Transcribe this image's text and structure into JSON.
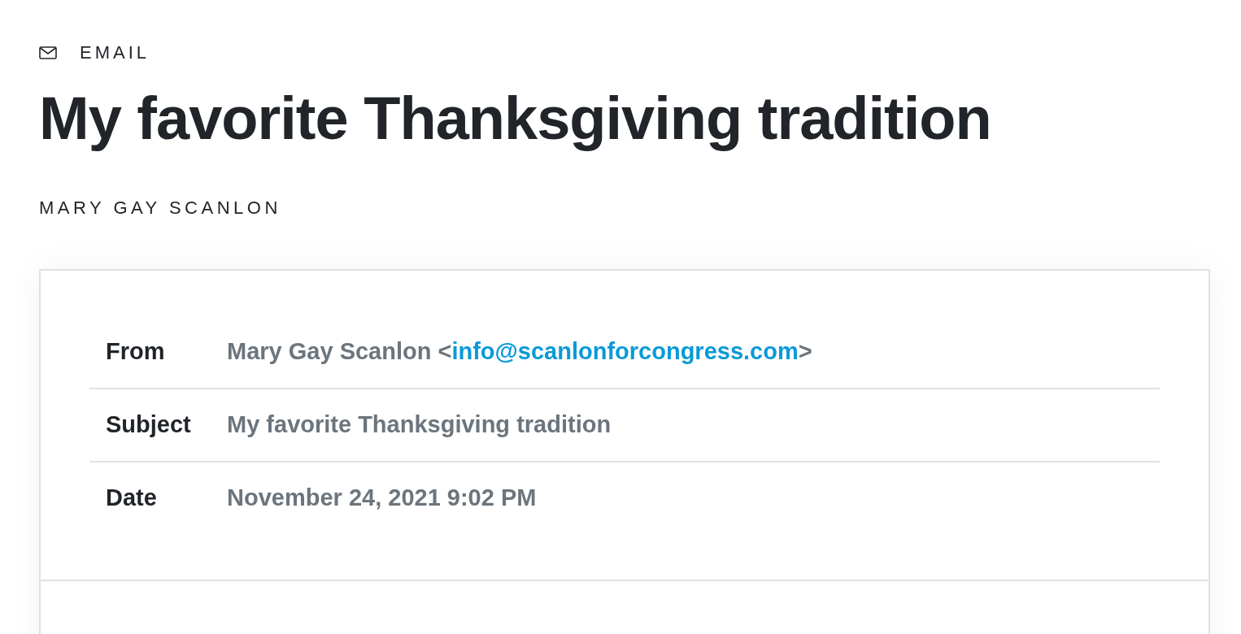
{
  "category": {
    "label": "EMAIL"
  },
  "title": "My favorite Thanksgiving tradition",
  "author": "MARY GAY SCANLON",
  "headers": [
    {
      "kind": "link",
      "label": "From",
      "before": "Mary Gay Scanlon <",
      "link": "info@scanlonforcongress.com",
      "after": ">"
    },
    {
      "kind": "text",
      "label": "Subject",
      "value": "My favorite Thanksgiving tradition"
    },
    {
      "kind": "text",
      "label": "Date",
      "value": "November 24, 2021 9:02 PM"
    }
  ]
}
